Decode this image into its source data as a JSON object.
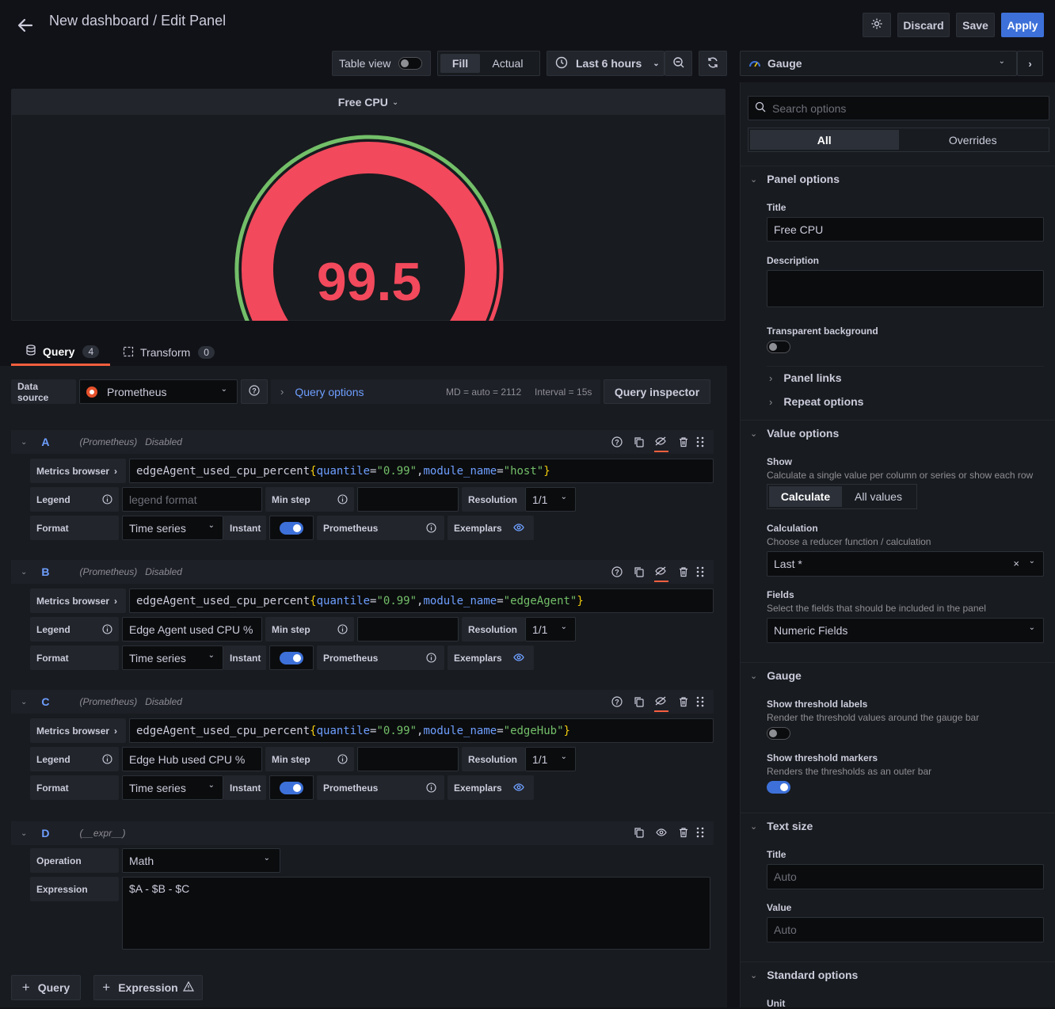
{
  "header": {
    "title": "New dashboard / Edit Panel",
    "discard": "Discard",
    "save": "Save",
    "apply": "Apply"
  },
  "toolbar": {
    "table_view": "Table view",
    "fill": "Fill",
    "actual": "Actual",
    "time_range": "Last 6 hours",
    "visualization": "Gauge"
  },
  "panel": {
    "title": "Free CPU",
    "value": "99.5",
    "value_numeric": 99.5,
    "gauge_color": "#f2495c",
    "threshold_color": "#73bf69"
  },
  "tabs": {
    "query": "Query",
    "query_count": "4",
    "transform": "Transform",
    "transform_count": "0"
  },
  "datasource": {
    "label": "Data source",
    "name": "Prometheus",
    "query_options": "Query options",
    "md": "MD = auto = 2112",
    "interval": "Interval = 15s",
    "inspector": "Query inspector"
  },
  "queries": [
    {
      "letter": "A",
      "ds": "(Prometheus)",
      "status": "Disabled",
      "metrics_browser": "Metrics browser",
      "expr_metric": "edgeAgent_used_cpu_percent",
      "expr_open": "{",
      "k1": "quantile",
      "eq": "=",
      "v1": "\"0.99\"",
      "comma": ",",
      "k2": "module_name",
      "v2": "\"host\"",
      "expr_close": "}",
      "legend_label": "Legend",
      "legend_value": "",
      "legend_placeholder": "legend format",
      "min_step": "Min step",
      "resolution": "Resolution",
      "resolution_value": "1/1",
      "format_label": "Format",
      "format_value": "Time series",
      "instant": "Instant",
      "type": "Prometheus",
      "exemplars": "Exemplars"
    },
    {
      "letter": "B",
      "ds": "(Prometheus)",
      "status": "Disabled",
      "metrics_browser": "Metrics browser",
      "expr_metric": "edgeAgent_used_cpu_percent",
      "expr_open": "{",
      "k1": "quantile",
      "eq": "=",
      "v1": "\"0.99\"",
      "comma": ",",
      "k2": "module_name",
      "v2": "\"edgeAgent\"",
      "expr_close": "}",
      "legend_label": "Legend",
      "legend_value": "Edge Agent used CPU %",
      "legend_placeholder": "",
      "min_step": "Min step",
      "resolution": "Resolution",
      "resolution_value": "1/1",
      "format_label": "Format",
      "format_value": "Time series",
      "instant": "Instant",
      "type": "Prometheus",
      "exemplars": "Exemplars"
    },
    {
      "letter": "C",
      "ds": "(Prometheus)",
      "status": "Disabled",
      "metrics_browser": "Metrics browser",
      "expr_metric": "edgeAgent_used_cpu_percent",
      "expr_open": "{",
      "k1": "quantile",
      "eq": "=",
      "v1": "\"0.99\"",
      "comma": ",",
      "k2": "module_name",
      "v2": "\"edgeHub\"",
      "expr_close": "}",
      "legend_label": "Legend",
      "legend_value": "Edge Hub used CPU %",
      "legend_placeholder": "",
      "min_step": "Min step",
      "resolution": "Resolution",
      "resolution_value": "1/1",
      "format_label": "Format",
      "format_value": "Time series",
      "instant": "Instant",
      "type": "Prometheus",
      "exemplars": "Exemplars"
    }
  ],
  "expression": {
    "letter": "D",
    "ds": "(__expr__)",
    "operation_label": "Operation",
    "operation_value": "Math",
    "expression_label": "Expression",
    "expression_value": "$A - $B - $C"
  },
  "add_buttons": {
    "query": "Query",
    "expression": "Expression"
  },
  "options": {
    "search_placeholder": "Search options",
    "tab_all": "All",
    "tab_overrides": "Overrides",
    "panel_options": {
      "header": "Panel options",
      "title_label": "Title",
      "title_value": "Free CPU",
      "description_label": "Description",
      "transparent_label": "Transparent background",
      "panel_links": "Panel links",
      "repeat_options": "Repeat options"
    },
    "value_options": {
      "header": "Value options",
      "show_label": "Show",
      "show_desc": "Calculate a single value per column or series or show each row",
      "calculate": "Calculate",
      "all_values": "All values",
      "calculation_label": "Calculation",
      "calculation_desc": "Choose a reducer function / calculation",
      "calculation_value": "Last *",
      "fields_label": "Fields",
      "fields_desc": "Select the fields that should be included in the panel",
      "fields_value": "Numeric Fields"
    },
    "gauge": {
      "header": "Gauge",
      "threshold_labels": "Show threshold labels",
      "threshold_labels_desc": "Render the threshold values around the gauge bar",
      "threshold_markers": "Show threshold markers",
      "threshold_markers_desc": "Renders the thresholds as an outer bar"
    },
    "text_size": {
      "header": "Text size",
      "title_label": "Title",
      "title_placeholder": "Auto",
      "value_label": "Value",
      "value_placeholder": "Auto"
    },
    "standard_options": {
      "header": "Standard options",
      "unit_label": "Unit"
    }
  }
}
